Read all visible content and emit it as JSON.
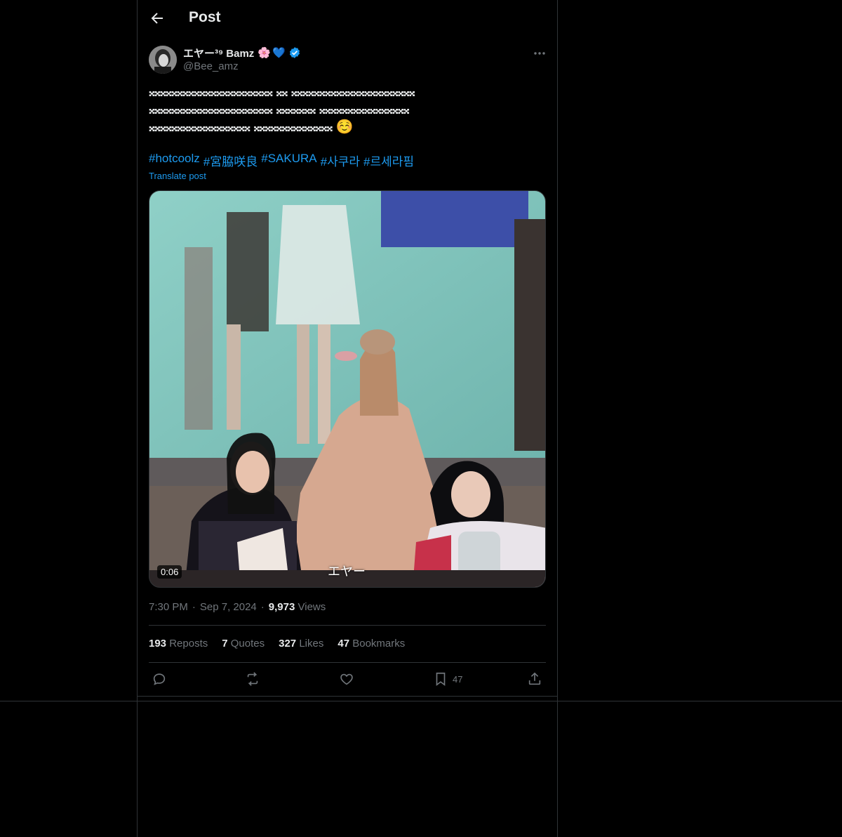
{
  "header": {
    "title": "Post"
  },
  "author": {
    "display_name": "エヤー³⁹ Bamz",
    "handle": "@Bee_amz",
    "emoji": [
      "🌸",
      "💙"
    ],
    "verified": true
  },
  "tweet": {
    "text": "𝄪𝄪𝄪𝄪𝄪𝄪𝄪𝄪𝄪𝄪𝄪𝄪𝄪𝄪𝄪𝄪𝄪𝄪𝄪𝄪𝄪𝄪 𝄪𝄪 𝄪𝄪𝄪𝄪𝄪𝄪𝄪𝄪𝄪𝄪𝄪𝄪𝄪𝄪𝄪𝄪𝄪𝄪𝄪𝄪𝄪𝄪\n𝄪𝄪𝄪𝄪𝄪𝄪𝄪𝄪𝄪𝄪𝄪𝄪𝄪𝄪𝄪𝄪𝄪𝄪𝄪𝄪𝄪𝄪 𝄪𝄪𝄪𝄪𝄪𝄪𝄪 𝄪𝄪𝄪𝄪𝄪𝄪𝄪𝄪𝄪𝄪𝄪𝄪𝄪𝄪𝄪𝄪\n𝄪𝄪𝄪𝄪𝄪𝄪𝄪𝄪𝄪𝄪𝄪𝄪𝄪𝄪𝄪𝄪𝄪𝄪 𝄪𝄪𝄪𝄪𝄪𝄪𝄪𝄪𝄪𝄪𝄪𝄪𝄪𝄪 ☺️",
    "hashtags": [
      "#hotcoolz",
      "#宮脇咲良",
      "#SAKURA",
      "#사쿠라",
      "#르세라핌"
    ],
    "translate_label": "Translate post"
  },
  "media": {
    "duration": "0:06",
    "subtitle": "エヤー"
  },
  "meta": {
    "time": "7:30 PM",
    "date": "Sep 7, 2024",
    "views": "9,973",
    "views_label": "Views",
    "sep": "·"
  },
  "stats": {
    "reposts": "193",
    "reposts_label": "Reposts",
    "quotes": "7",
    "quotes_label": "Quotes",
    "likes": "327",
    "likes_label": "Likes",
    "bookmarks": "47",
    "bookmarks_label": "Bookmarks"
  },
  "actions": {
    "bookmark_count": "47"
  },
  "colors": {
    "accent": "#1d9bf0",
    "background": "#000000",
    "muted": "#71767b",
    "border": "#2f3336"
  },
  "icons": [
    "back-arrow-icon",
    "verified-badge-icon",
    "more-icon",
    "reply-icon",
    "repost-icon",
    "like-icon",
    "bookmark-icon",
    "share-icon"
  ]
}
